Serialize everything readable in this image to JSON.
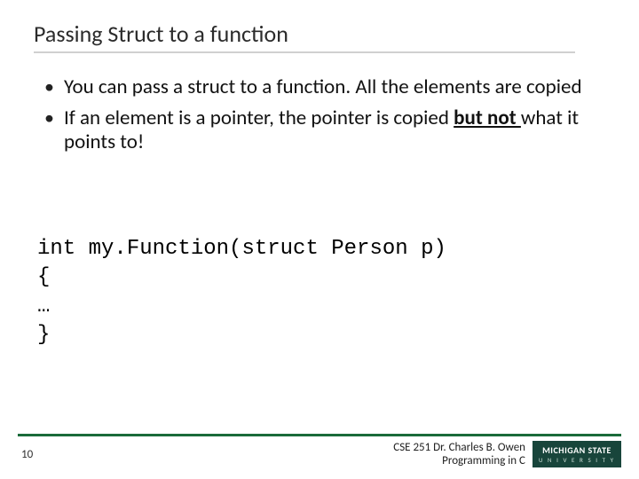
{
  "title": "Passing Struct to a function",
  "bullets": [
    {
      "pre": "You can pass a struct to a function. All the elements are copied"
    },
    {
      "pre": "If an element is a pointer, the pointer is copied ",
      "u1": "but not ",
      "post": "what it points to!"
    }
  ],
  "code": {
    "l0": "int my.Function(struct Person p)",
    "l1": "{",
    "l2": "…",
    "l3": "}"
  },
  "footer": {
    "page": "10",
    "credit_line1": "CSE 251 Dr. Charles B. Owen",
    "credit_line2": "Programming in C",
    "logo_main": "MICHIGAN STATE",
    "logo_sub": "U N I V E R S I T Y"
  },
  "colors": {
    "accent": "#18453b",
    "rule": "#1a6b3a"
  }
}
